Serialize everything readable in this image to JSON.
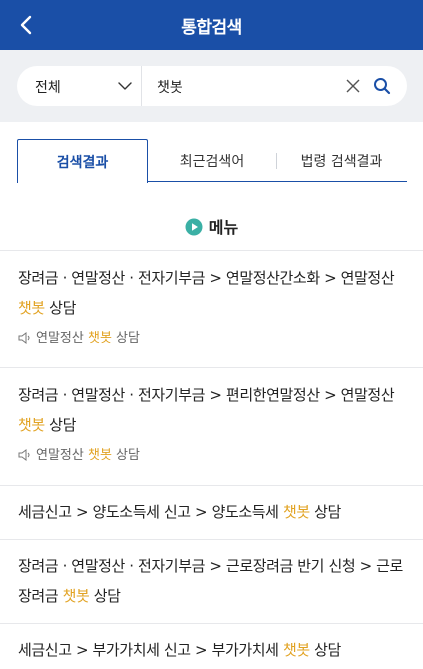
{
  "header": {
    "title": "통합검색"
  },
  "search": {
    "scope": "전체",
    "query": "챗봇"
  },
  "tabs": [
    "검색결과",
    "최근검색어",
    "법령 검색결과"
  ],
  "section": {
    "title": "메뉴"
  },
  "results": [
    {
      "path_before": "장려금 · 연말정산 · 전자기부금 > 연말정산간소화 > 연말정산 ",
      "highlight": "챗봇",
      "path_after": " 상담",
      "sub_before": "연말정산 ",
      "sub_highlight": "챗봇",
      "sub_after": " 상담"
    },
    {
      "path_before": "장려금 · 연말정산 · 전자기부금 > 편리한연말정산 > 연말정산 ",
      "highlight": "챗봇",
      "path_after": " 상담",
      "sub_before": "연말정산 ",
      "sub_highlight": "챗봇",
      "sub_after": " 상담"
    },
    {
      "path_before": "세금신고 > 양도소득세 신고 > 양도소득세 ",
      "highlight": "챗봇",
      "path_after": " 상담"
    },
    {
      "path_before": "장려금 · 연말정산 · 전자기부금 > 근로장려금 반기 신청 > 근로장려금 ",
      "highlight": "챗봇",
      "path_after": " 상담"
    },
    {
      "path_before": "세금신고 > 부가가치세 신고 > 부가가치세 ",
      "highlight": "챗봇",
      "path_after": " 상담"
    }
  ],
  "colors": {
    "brand": "#1a4fa7",
    "highlight": "#e2a323",
    "search_bg": "#eef0f3",
    "play_icon": "#3bb0a5"
  },
  "icons": {
    "back": "chevron-left-icon",
    "dropdown": "chevron-down-icon",
    "clear": "close-icon",
    "search": "search-icon",
    "section": "play-circle-icon",
    "sub": "speaker-icon"
  }
}
